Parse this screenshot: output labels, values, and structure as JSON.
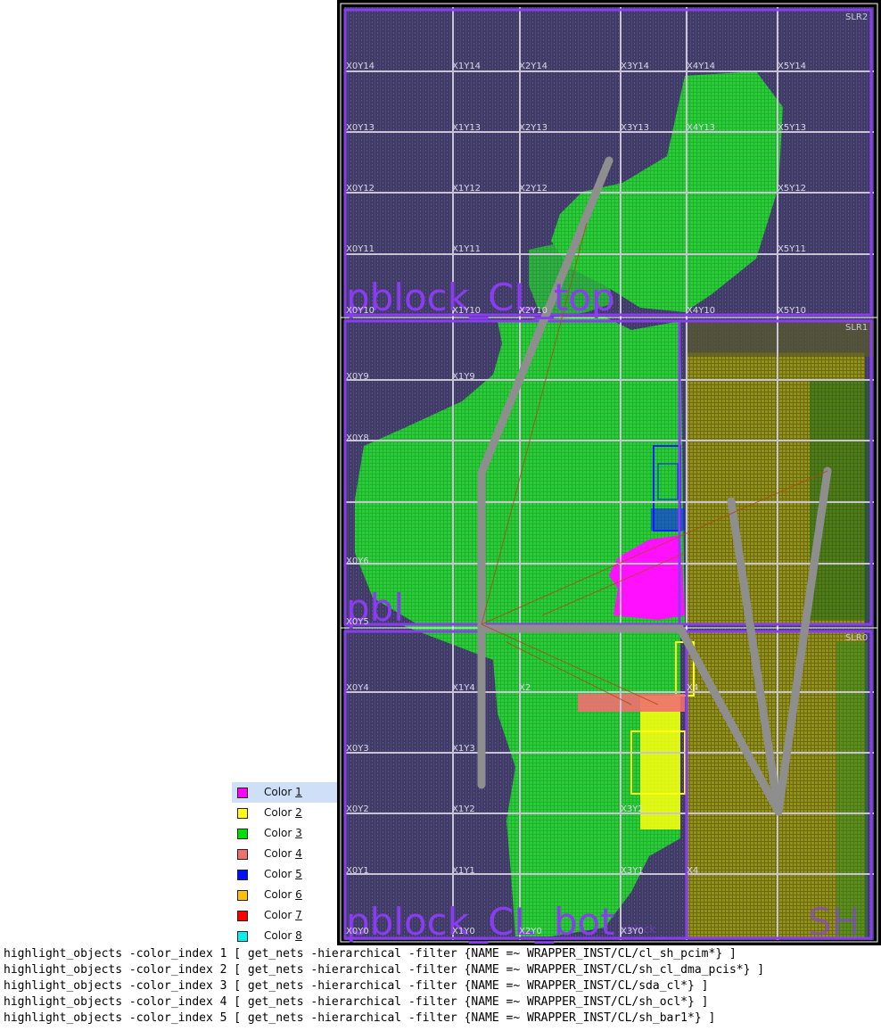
{
  "device": {
    "slr_labels": [
      "SLR2",
      "SLR1",
      "SLR0"
    ],
    "pblock_labels": {
      "top": "pblock_CL_top",
      "mid": "pbl",
      "bot": "pblock_CL_bot",
      "bot_small": "pblock",
      "right": "SH"
    },
    "clock_regions": [
      [
        "X0Y14",
        "X1Y14",
        "X2Y14",
        "X3Y14",
        "X4Y14",
        "X5Y14"
      ],
      [
        "X0Y13",
        "X1Y13",
        "X2Y13",
        "X3Y13",
        "X4Y13",
        "X5Y13"
      ],
      [
        "X0Y12",
        "X1Y12",
        "X2Y12",
        "",
        "",
        "X5Y12"
      ],
      [
        "X0Y11",
        "X1Y11",
        "",
        "",
        "",
        "X5Y11"
      ],
      [
        "X0Y10",
        "X1Y10",
        "X2Y10",
        "",
        "X4Y10",
        "X5Y10"
      ],
      [
        "X0Y9",
        "X1Y9",
        "",
        "",
        "",
        ""
      ],
      [
        "X0Y8",
        "",
        "",
        "",
        "",
        ""
      ],
      [
        "X0Y6",
        "",
        "",
        "",
        "",
        ""
      ],
      [
        "X0Y5",
        "",
        "",
        "",
        "",
        ""
      ],
      [
        "X0Y4",
        "X1Y4",
        "X2",
        "",
        "X4",
        ""
      ],
      [
        "X0Y3",
        "X1Y3",
        "",
        "",
        "",
        ""
      ],
      [
        "X0Y2",
        "X1Y2",
        "",
        "X3Y2",
        "",
        ""
      ],
      [
        "X0Y1",
        "X1Y1",
        "",
        "X3Y1",
        "X4",
        ""
      ],
      [
        "X0Y0",
        "X1Y0",
        "X2Y0",
        "X3Y0",
        "",
        ""
      ]
    ],
    "colors": {
      "fabric": "#3f3a66",
      "clock_grid": "#c9c3d4",
      "pblock": "#8a3cf0",
      "placement": "#1fd428",
      "shell": "#8f8a14",
      "ratsnest": "#8e8e8e"
    }
  },
  "color_menu": {
    "items": [
      {
        "prefix": "Color ",
        "num": "1",
        "color": "#ff00ff",
        "selected": true
      },
      {
        "prefix": "Color ",
        "num": "2",
        "color": "#ffff00",
        "selected": false
      },
      {
        "prefix": "Color ",
        "num": "3",
        "color": "#00e000",
        "selected": false
      },
      {
        "prefix": "Color ",
        "num": "4",
        "color": "#f07070",
        "selected": false
      },
      {
        "prefix": "Color ",
        "num": "5",
        "color": "#0010ff",
        "selected": false
      },
      {
        "prefix": "Color ",
        "num": "6",
        "color": "#ffc000",
        "selected": false
      },
      {
        "prefix": "Color ",
        "num": "7",
        "color": "#ff0000",
        "selected": false
      },
      {
        "prefix": "Color ",
        "num": "8",
        "color": "#00f0f0",
        "selected": false
      }
    ]
  },
  "console": {
    "lines": [
      "highlight_objects -color_index 1 [ get_nets -hierarchical -filter {NAME =~ WRAPPER_INST/CL/cl_sh_pcim*} ]",
      "highlight_objects -color_index 2 [ get_nets -hierarchical -filter {NAME =~ WRAPPER_INST/CL/sh_cl_dma_pcis*} ]",
      "highlight_objects -color_index 3 [ get_nets -hierarchical -filter {NAME =~ WRAPPER_INST/CL/sda_cl*} ]",
      "highlight_objects -color_index 4 [ get_nets -hierarchical -filter {NAME =~ WRAPPER_INST/CL/sh_ocl*} ]",
      "highlight_objects -color_index 5 [ get_nets -hierarchical -filter {NAME =~ WRAPPER_INST/CL/sh_bar1*} ]"
    ]
  }
}
